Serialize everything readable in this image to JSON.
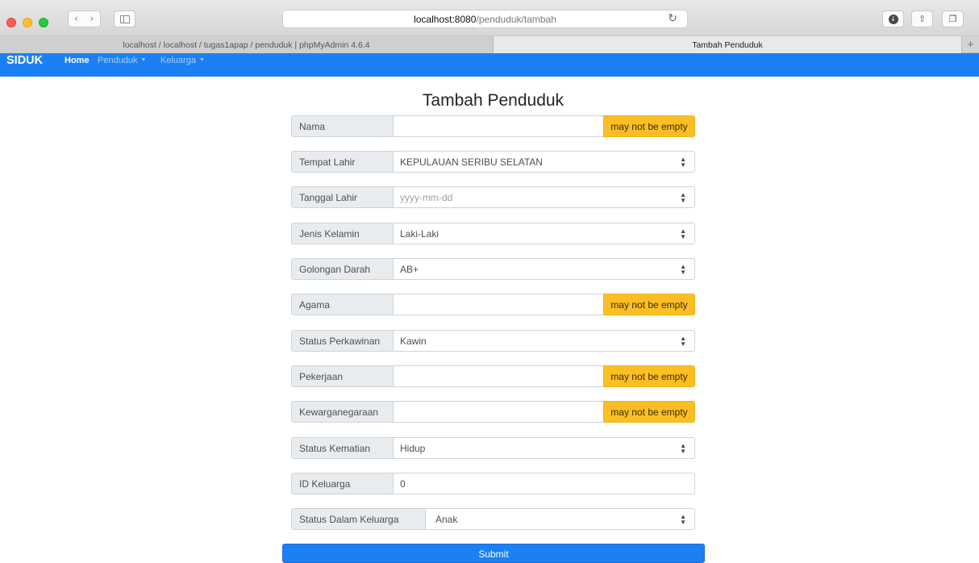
{
  "browser": {
    "url_host": "localhost:8080",
    "url_path": "/penduduk/tambah",
    "tabs": [
      {
        "title": "localhost / localhost / tugas1apap / penduduk | phpMyAdmin 4.6.4"
      },
      {
        "title": "Tambah Penduduk"
      }
    ],
    "new_tab_label": "+"
  },
  "navbar": {
    "brand": "SIDUK",
    "items": [
      {
        "label": "Home"
      },
      {
        "label": "Penduduk"
      },
      {
        "label": "Keluarga"
      }
    ]
  },
  "form": {
    "title": "Tambah Penduduk",
    "fields": [
      {
        "label": "Nama",
        "value": "",
        "error": "may not be empty"
      },
      {
        "label": "Tempat Lahir",
        "value": "KEPULAUAN SERIBU SELATAN"
      },
      {
        "label": "Tanggal Lahir",
        "placeholder": "yyyy-mm-dd"
      },
      {
        "label": "Jenis Kelamin",
        "value": "Laki-Laki"
      },
      {
        "label": "Golongan Darah",
        "value": "AB+"
      },
      {
        "label": "Agama",
        "value": "",
        "error": "may not be empty"
      },
      {
        "label": "Status Perkawinan",
        "value": "Kawin"
      },
      {
        "label": "Pekerjaan",
        "value": "",
        "error": "may not be empty"
      },
      {
        "label": "Kewarganegaraan",
        "value": "",
        "error": "may not be empty"
      },
      {
        "label": "Status Kematian",
        "value": "Hidup"
      },
      {
        "label": "ID Keluarga",
        "value": "0"
      },
      {
        "label": "Status Dalam Keluarga",
        "value": "Anak"
      }
    ],
    "submit_label": "Submit"
  },
  "colors": {
    "primary": "#1b80f3",
    "warning": "#fbbe24",
    "addon_bg": "#e9ecef"
  }
}
